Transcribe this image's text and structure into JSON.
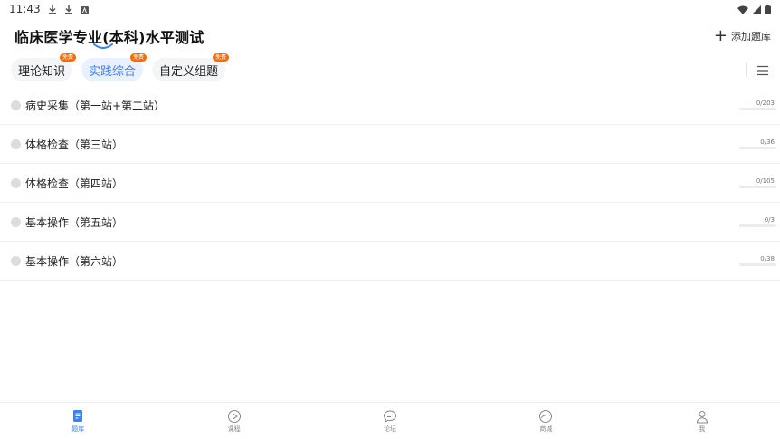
{
  "status": {
    "time": "11:43"
  },
  "header": {
    "title": "临床医学专业(本科)水平测试",
    "add_label": "添加题库"
  },
  "tabs": [
    {
      "label": "理论知识",
      "badge": "免费",
      "active": false
    },
    {
      "label": "实践综合",
      "badge": "免费",
      "active": true
    },
    {
      "label": "自定义组题",
      "badge": "免费",
      "active": false
    }
  ],
  "list": [
    {
      "label": "病史采集（第一站+第二站）",
      "count": "0/203",
      "progress": 0
    },
    {
      "label": "体格检查（第三站）",
      "count": "0/36",
      "progress": 0
    },
    {
      "label": "体格检查（第四站）",
      "count": "0/105",
      "progress": 0
    },
    {
      "label": "基本操作（第五站）",
      "count": "0/3",
      "progress": 0
    },
    {
      "label": "基本操作（第六站）",
      "count": "0/38",
      "progress": 0
    }
  ],
  "nav": [
    {
      "label": "题库",
      "icon": "question-bank-icon",
      "active": true
    },
    {
      "label": "课程",
      "icon": "play-circle-icon",
      "active": false
    },
    {
      "label": "论坛",
      "icon": "chat-bubble-icon",
      "active": false
    },
    {
      "label": "商城",
      "icon": "shop-icon",
      "active": false
    },
    {
      "label": "我",
      "icon": "user-icon",
      "active": false
    }
  ],
  "colors": {
    "accent": "#3b82f6",
    "badge": "#ff6a00"
  }
}
